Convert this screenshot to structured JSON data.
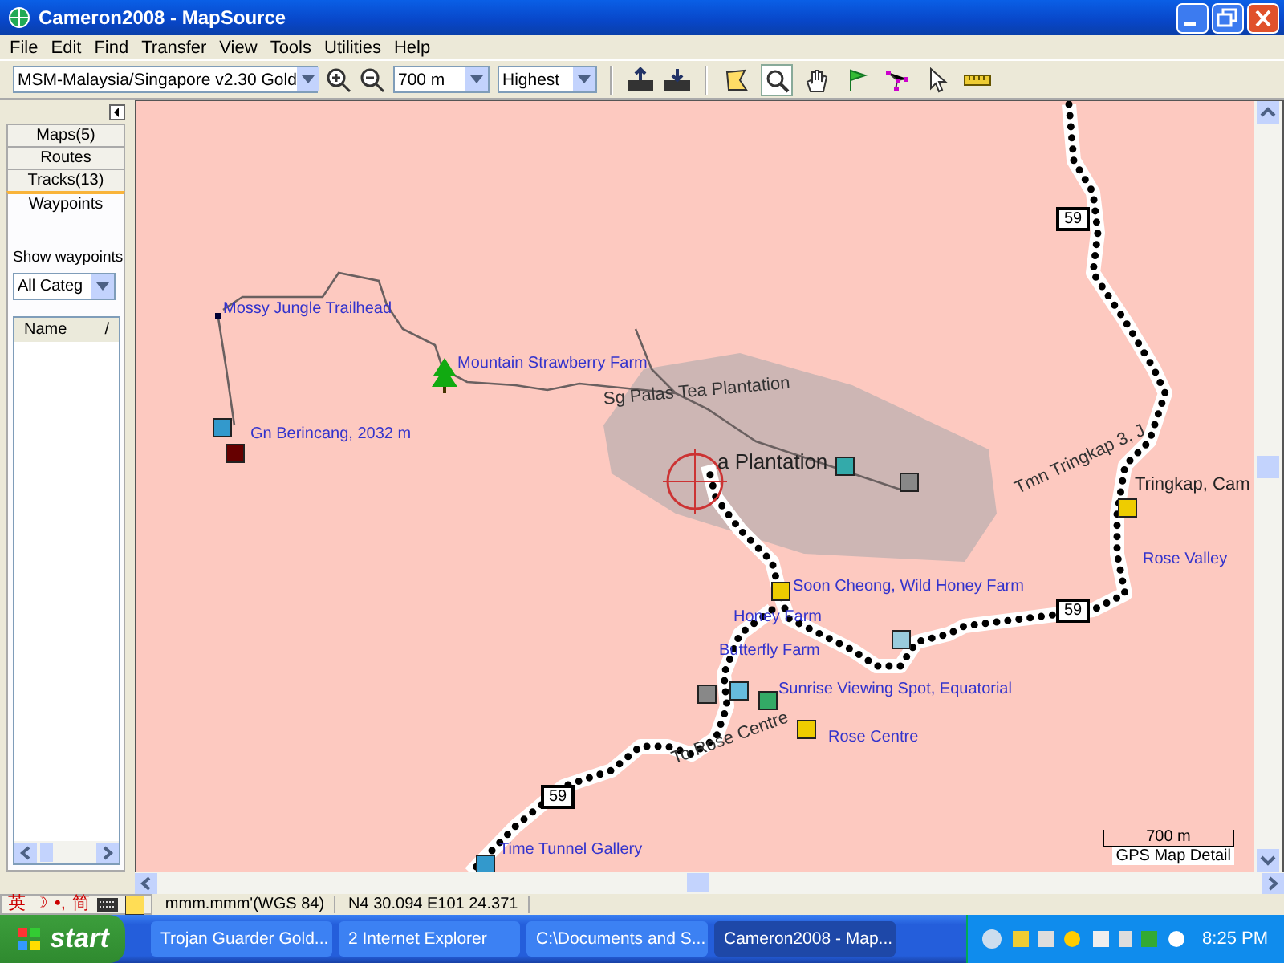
{
  "window": {
    "title": "Cameron2008 - MapSource"
  },
  "menu": [
    "File",
    "Edit",
    "Find",
    "Transfer",
    "View",
    "Tools",
    "Utilities",
    "Help"
  ],
  "toolbar": {
    "map_product": "MSM-Malaysia/Singapore v2.30 Gold",
    "zoom_level": "700 m",
    "detail": "Highest",
    "tools": [
      {
        "kind": "select-map",
        "selected": false
      },
      {
        "kind": "zoom",
        "selected": true
      },
      {
        "kind": "hand",
        "selected": false
      },
      {
        "kind": "waypoint",
        "selected": false
      },
      {
        "kind": "route",
        "selected": false
      },
      {
        "kind": "selection",
        "selected": false
      },
      {
        "kind": "distance",
        "selected": false
      }
    ]
  },
  "sidebar": {
    "tabs": [
      {
        "label": "Maps(5)",
        "selected": false
      },
      {
        "label": "Routes",
        "selected": false
      },
      {
        "label": "Tracks(13)",
        "selected": false
      },
      {
        "label": "Waypoints",
        "selected": true
      }
    ],
    "show_label": "Show waypoints",
    "category": "All Categ",
    "column": "Name",
    "sort_mark": "/"
  },
  "map": {
    "labels": [
      {
        "text": "Mossy Jungle Trailhead",
        "kind": "waypoint"
      },
      {
        "text": "Mountain  Strawberry Farm",
        "kind": "waypoint"
      },
      {
        "text": "Gn Berincang, 2032 m",
        "kind": "waypoint"
      },
      {
        "text": "Sg Palas Tea Plantation",
        "kind": "road"
      },
      {
        "text": "a Plantation",
        "kind": "area"
      },
      {
        "text": "Tmn Tringkap 3, J",
        "kind": "road"
      },
      {
        "text": "Tringkap, Cam",
        "kind": "place"
      },
      {
        "text": "Rose Valley",
        "kind": "waypoint"
      },
      {
        "text": "Soon Cheong, Wild Honey Farm",
        "kind": "waypoint"
      },
      {
        "text": "Honey Farm",
        "kind": "waypoint"
      },
      {
        "text": "Butterfly Farm",
        "kind": "waypoint"
      },
      {
        "text": "Sunrise Viewing Spot, Equatorial",
        "kind": "waypoint"
      },
      {
        "text": "Rose Centre",
        "kind": "waypoint"
      },
      {
        "text": "To Rose Centre",
        "kind": "road"
      },
      {
        "text": "Time Tunnel Gallery",
        "kind": "waypoint"
      }
    ],
    "shields": [
      "59",
      "59",
      "59"
    ],
    "scale": "700 m",
    "detail_label": "GPS Map Detail"
  },
  "status_bar": {
    "ime": [
      "英",
      "☽",
      "•,",
      "简"
    ],
    "format": "mmm.mmm'(WGS 84)",
    "position": "N4 30.094 E101 24.371"
  },
  "taskbar": {
    "start": "start",
    "buttons": [
      {
        "label": "Trojan Guarder Gold...",
        "selected": false
      },
      {
        "label": "2 Internet Explorer",
        "selected": false
      },
      {
        "label": "C:\\Documents and S...",
        "selected": false
      },
      {
        "label": "Cameron2008 - Map...",
        "selected": true
      }
    ],
    "clock": "8:25 PM"
  }
}
